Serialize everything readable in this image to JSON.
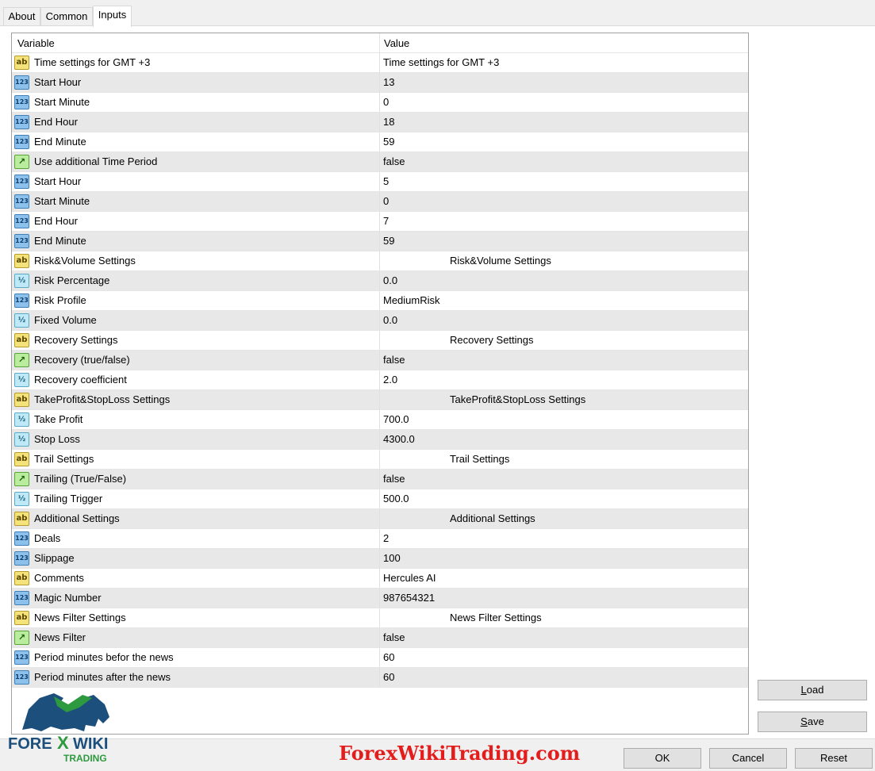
{
  "tabs": [
    {
      "label": "About"
    },
    {
      "label": "Common"
    },
    {
      "label": "Inputs"
    }
  ],
  "columns": {
    "variable": "Variable",
    "value": "Value"
  },
  "rows": [
    {
      "type": "ab",
      "variable": "Time settings for GMT +3",
      "value": "Time settings for GMT +3",
      "center": false
    },
    {
      "type": "int",
      "variable": "Start Hour",
      "value": "13",
      "center": false
    },
    {
      "type": "int",
      "variable": "Start Minute",
      "value": "0",
      "center": false
    },
    {
      "type": "int",
      "variable": "End Hour",
      "value": "18",
      "center": false
    },
    {
      "type": "int",
      "variable": "End Minute",
      "value": "59",
      "center": false
    },
    {
      "type": "bool",
      "variable": "Use additional Time Period",
      "value": "false",
      "center": false
    },
    {
      "type": "int",
      "variable": "Start Hour",
      "value": "5",
      "center": false
    },
    {
      "type": "int",
      "variable": "Start Minute",
      "value": "0",
      "center": false
    },
    {
      "type": "int",
      "variable": "End Hour",
      "value": "7",
      "center": false
    },
    {
      "type": "int",
      "variable": "End Minute",
      "value": "59",
      "center": false
    },
    {
      "type": "ab",
      "variable": "Risk&Volume Settings",
      "value": "Risk&Volume Settings",
      "center": true
    },
    {
      "type": "dbl",
      "variable": "Risk Percentage",
      "value": "0.0",
      "center": false
    },
    {
      "type": "int",
      "variable": "Risk Profile",
      "value": "MediumRisk",
      "center": false
    },
    {
      "type": "dbl",
      "variable": "Fixed Volume",
      "value": "0.0",
      "center": false
    },
    {
      "type": "ab",
      "variable": "Recovery Settings",
      "value": "Recovery Settings",
      "center": true
    },
    {
      "type": "bool",
      "variable": "Recovery (true/false)",
      "value": "false",
      "center": false
    },
    {
      "type": "dbl",
      "variable": "Recovery coefficient",
      "value": "2.0",
      "center": false
    },
    {
      "type": "ab",
      "variable": "TakeProfit&StopLoss Settings",
      "value": "TakeProfit&StopLoss Settings",
      "center": true
    },
    {
      "type": "dbl",
      "variable": "Take Profit",
      "value": "700.0",
      "center": false
    },
    {
      "type": "dbl",
      "variable": "Stop Loss",
      "value": "4300.0",
      "center": false
    },
    {
      "type": "ab",
      "variable": "Trail Settings",
      "value": "Trail Settings",
      "center": true
    },
    {
      "type": "bool",
      "variable": "Trailing (True/False)",
      "value": "false",
      "center": false
    },
    {
      "type": "dbl",
      "variable": "Trailing Trigger",
      "value": "500.0",
      "center": false
    },
    {
      "type": "ab",
      "variable": "Additional Settings",
      "value": "Additional Settings",
      "center": true
    },
    {
      "type": "int",
      "variable": "Deals",
      "value": "2",
      "center": false
    },
    {
      "type": "int",
      "variable": "Slippage",
      "value": "100",
      "center": false
    },
    {
      "type": "ab",
      "variable": "Comments",
      "value": "Hercules AI",
      "center": false
    },
    {
      "type": "int",
      "variable": "Magic Number",
      "value": "987654321",
      "center": false
    },
    {
      "type": "ab",
      "variable": "News Filter Settings",
      "value": "News Filter Settings",
      "center": true
    },
    {
      "type": "bool",
      "variable": "News Filter",
      "value": "false",
      "center": false
    },
    {
      "type": "int",
      "variable": "Period minutes befor the news",
      "value": "60",
      "center": false
    },
    {
      "type": "int",
      "variable": "Period minutes after the news",
      "value": "60",
      "center": false
    }
  ],
  "icons": {
    "ab": "ab",
    "int": "123",
    "bool": "↗",
    "dbl": "½"
  },
  "buttons": {
    "load": "Load",
    "save": "Save",
    "ok": "OK",
    "cancel": "Cancel",
    "reset": "Reset"
  },
  "watermark": "ForexWikiTrading.com",
  "logo": {
    "line1": "FOREX WIKI",
    "line2": "TRADING"
  },
  "colors": {
    "watermark": "#e31c1c",
    "logo_blue": "#1c4f7c",
    "logo_green": "#2e9a3f"
  }
}
